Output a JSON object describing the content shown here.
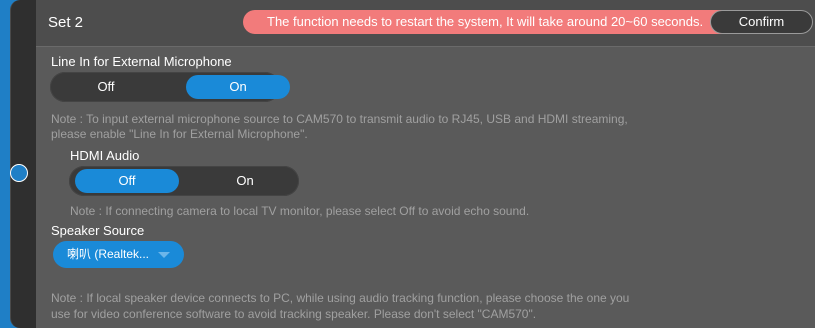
{
  "header": {
    "title": "Set 2",
    "warning": "The function needs to restart the system, It will take around 20~60 seconds.",
    "confirm_label": "Confirm"
  },
  "line_in": {
    "label": "Line In for External Microphone",
    "options": [
      "Off",
      "On"
    ],
    "selected": "On",
    "note_line1": "Note : To input external microphone source to CAM570 to transmit audio to RJ45, USB and HDMI streaming,",
    "note_line2": "please enable \"Line In for External Microphone\"."
  },
  "hdmi_audio": {
    "label": "HDMI Audio",
    "options": [
      "Off",
      "On"
    ],
    "selected": "Off",
    "note": "Note : If connecting camera to local TV monitor, please select Off to avoid echo sound."
  },
  "speaker_source": {
    "label": "Speaker Source",
    "selected_value": "喇叭 (Realtek...",
    "note_line1": "Note : If local speaker device connects to PC, while using audio tracking function, please choose the one you",
    "note_line2": "use for video conference software to avoid tracking speaker. Please don't select \"CAM570\"."
  },
  "colors": {
    "accent": "#1a8ad8",
    "warning_bg": "#f27b7b",
    "panel_bg": "#5a5a5a",
    "rail": "#1f7fc6"
  }
}
